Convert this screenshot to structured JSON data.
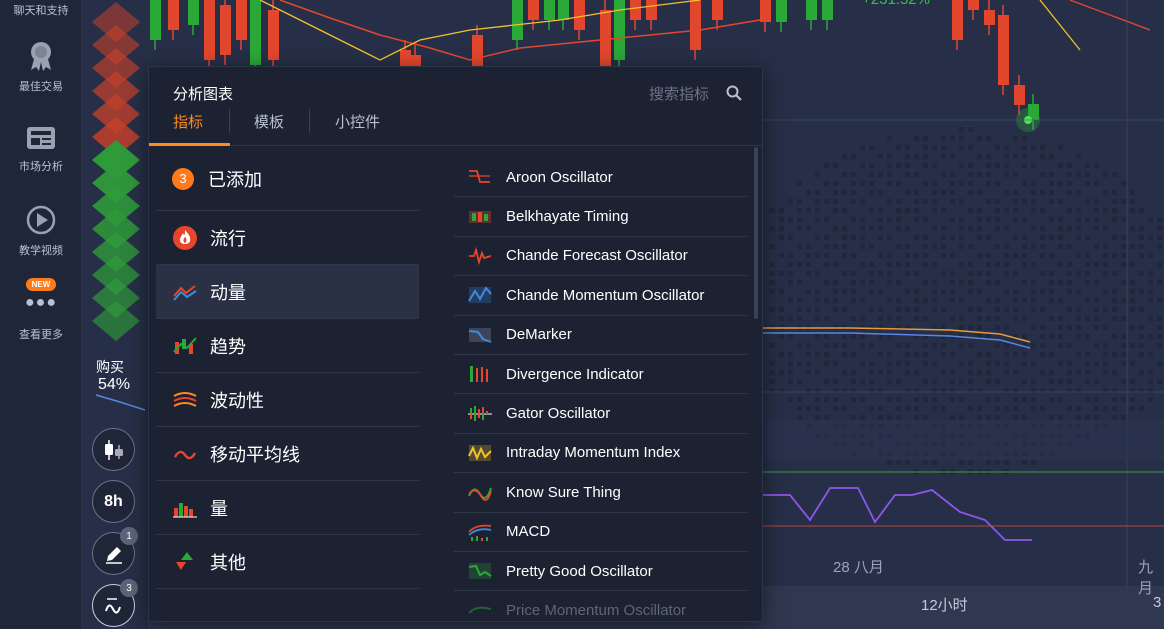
{
  "sidebar": {
    "top_label": "聊天和支持",
    "items": [
      {
        "label": "最佳交易",
        "icon": "award-icon"
      },
      {
        "label": "市场分析",
        "icon": "newspaper-icon"
      },
      {
        "label": "教学视频",
        "icon": "play-icon"
      },
      {
        "label": "查看更多",
        "icon": "more-icon",
        "badge": "NEW"
      }
    ]
  },
  "chart": {
    "profit_label": "+231.52%",
    "buy_label": "购买",
    "buy_percent": "54%",
    "date_label": "28 八月",
    "date_label_2": "九月",
    "timeframe_label": "12小时",
    "timeframe_label_2": "3",
    "colors": {
      "up": "#2aa838",
      "down": "#e2472e",
      "bg": "#262f47"
    }
  },
  "tools": {
    "candle_icon": "candlestick-icon",
    "interval": "8h",
    "drawing_count": "1",
    "indicator_count": "3"
  },
  "panel": {
    "title": "分析图表",
    "search_placeholder": "搜索指标",
    "tabs": [
      "指标",
      "模板",
      "小控件"
    ],
    "added_count": "3",
    "categories": [
      {
        "label": "已添加",
        "icon": "count-badge"
      },
      {
        "label": "流行",
        "icon": "fire-icon"
      },
      {
        "label": "动量",
        "icon": "momentum-icon"
      },
      {
        "label": "趋势",
        "icon": "trend-icon"
      },
      {
        "label": "波动性",
        "icon": "volatility-icon"
      },
      {
        "label": "移动平均线",
        "icon": "moving-average-icon"
      },
      {
        "label": "量",
        "icon": "volume-icon"
      },
      {
        "label": "其他",
        "icon": "other-icon"
      }
    ],
    "indicators": [
      "Aroon Oscillator",
      "Belkhayate Timing",
      "Chande Forecast Oscillator",
      "Chande Momentum Oscillator",
      "DeMarker",
      "Divergence Indicator",
      "Gator Oscillator",
      "Intraday Momentum Index",
      "Know Sure Thing",
      "MACD",
      "Pretty Good Oscillator",
      "Price Momentum Oscillator"
    ]
  }
}
